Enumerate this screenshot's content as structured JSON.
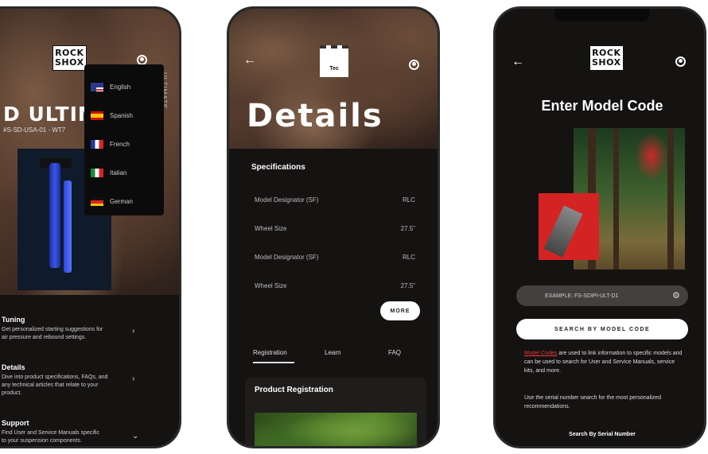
{
  "phone1": {
    "logo": {
      "line1": "ROCK",
      "line2": "SHOX"
    },
    "headline": "D ULTIM",
    "model_code": "#S-SD-USA-01 - WT7",
    "vertical_text": "ULTIMATE",
    "languages": [
      "English",
      "Spanish",
      "French",
      "Italian",
      "German"
    ],
    "menu": [
      {
        "title": "Tuning",
        "desc1": "Get personalized starting suggestions for",
        "desc2": "air pressure and rebound settings."
      },
      {
        "title": "Details",
        "desc1": "Dive into product specifications, FAQs, and",
        "desc2": "any technical articles that relate to your",
        "desc3": "product."
      },
      {
        "title": "Support",
        "desc1": "Find User and Service Manuals specific",
        "desc2": "to your suspension components."
      }
    ]
  },
  "phone2": {
    "top_icon_label": "Tec",
    "title": "Details",
    "spec_heading": "Specifications",
    "specs": [
      {
        "label": "Model Designator (SF)",
        "value": "RLC"
      },
      {
        "label": "Wheel Size",
        "value": "27.5\""
      },
      {
        "label": "Model Designator (SF)",
        "value": "RLC"
      },
      {
        "label": "Wheel Size",
        "value": "27.5\""
      }
    ],
    "more_label": "MORE",
    "tabs": [
      "Registration",
      "Learn",
      "FAQ"
    ],
    "card_title": "Product Registration"
  },
  "phone3": {
    "logo": {
      "line1": "ROCK",
      "line2": "SHOX"
    },
    "title": "Enter Model Code",
    "search_placeholder": "EXAMPLE: FS-SDIPI-ULT-D1",
    "search_button": "SEARCH BY MODEL CODE",
    "para1_link": "Model Codes",
    "para1_rest": " are used to link information to specific models and can be used to search for User and Service Manuals, service kits, and more.",
    "para2": "Use the serial number search for the most personalized recommendations.",
    "serial_link": "Search By Serial Number"
  },
  "colors": {
    "accent_red": "#e23c3c",
    "bg_dark": "#151212",
    "fork_blue": "#3a55e8"
  }
}
